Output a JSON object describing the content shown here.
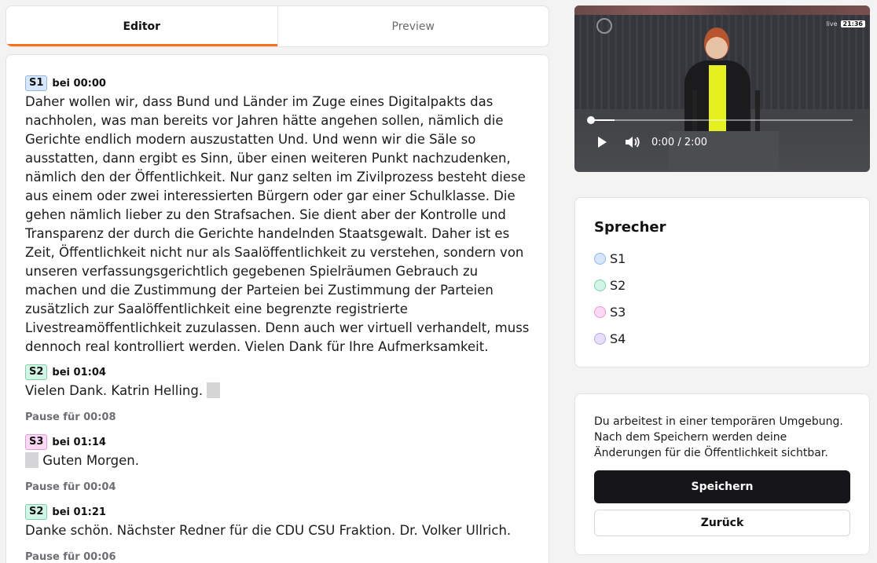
{
  "tabs": [
    {
      "label": "Editor",
      "active": true
    },
    {
      "label": "Preview",
      "active": false
    }
  ],
  "segments": [
    {
      "speaker": "S1",
      "time": "bei 00:00",
      "text": "Daher wollen wir, dass Bund und Länder im Zuge eines Digitalpakts das nachholen, was man bereits vor Jahren hätte angehen sollen, nämlich die Gerichte endlich modern auszustatten Und. Und wenn wir die Säle so ausstatten, dann ergibt es Sinn, über einen weiteren Punkt nachzudenken, nämlich den der Öffentlichkeit. Nur ganz selten im Zivilprozess besteht diese aus einem oder zwei interessierten Bürgern oder gar einer Schulklasse. Die gehen nämlich lieber zu den Strafsachen. Sie dient aber der Kontrolle und Transparenz der durch die Gerichte handelnden Staatsgewalt. Daher ist es Zeit, Öffentlichkeit nicht nur als Saalöffentlichkeit zu verstehen, sondern von unseren verfassungsgerichtlich gegebenen Spielräumen Gebrauch zu machen und die Zustimmung der Parteien bei Zustimmung der Parteien zusätzlich zur Saalöffentlichkeit eine begrenzte registrierte Livestreamöffentlichkeit zuzulassen. Denn auch wer virtuell verhandelt, muss dennoch real kontrolliert werden. Vielen Dank für Ihre Aufmerksamkeit."
    },
    {
      "speaker": "S2",
      "time": "bei 01:04",
      "text": "Vielen Dank. Katrin Helling."
    },
    {
      "pause": "Pause für 00:08"
    },
    {
      "speaker": "S3",
      "time": "bei 01:14",
      "text": "Guten Morgen."
    },
    {
      "pause": "Pause für 00:04"
    },
    {
      "speaker": "S2",
      "time": "bei 01:21",
      "text": "Danke schön. Nächster Redner für die CDU CSU Fraktion. Dr. Volker Ullrich."
    },
    {
      "pause": "Pause für 00:06"
    }
  ],
  "video": {
    "time_display": "0:00 / 2:00",
    "progress": 0.0,
    "buffered": 0.09,
    "overlay_time": "21:36",
    "overlay_live": "live",
    "play_icon": "play-icon",
    "volume_icon": "volume-icon"
  },
  "speakers_panel": {
    "title": "Sprecher",
    "items": [
      {
        "label": "S1",
        "fill": "#d6e6fb",
        "border": "#90b6ea"
      },
      {
        "label": "S2",
        "fill": "#d2f5e5",
        "border": "#7fd1aa"
      },
      {
        "label": "S3",
        "fill": "#fbd9f4",
        "border": "#e89ad8"
      },
      {
        "label": "S4",
        "fill": "#e6defb",
        "border": "#b7a5ea"
      }
    ]
  },
  "save_panel": {
    "notice": "Du arbeitest in einer temporären Umgebung. Nach dem Speichern werden deine Änderungen für die Öffentlichkeit sichtbar.",
    "save_label": "Speichern",
    "back_label": "Zurück"
  },
  "colors": {
    "accent": "#f97316",
    "primary_button": "#16161a"
  }
}
